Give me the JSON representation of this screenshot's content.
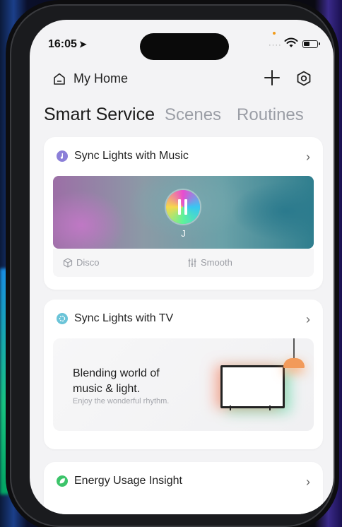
{
  "status": {
    "time": "16:05",
    "signal": "····"
  },
  "header": {
    "home_label": "My Home"
  },
  "tabs": [
    {
      "label": "Smart Service",
      "active": true
    },
    {
      "label": "Scenes",
      "active": false
    },
    {
      "label": "Routines",
      "active": false
    }
  ],
  "cards": {
    "music": {
      "title": "Sync Lights with Music",
      "player_name": "J",
      "mode_left": "Disco",
      "mode_right": "Smooth",
      "icon_color": "#8b7fd8"
    },
    "tv": {
      "title": "Sync Lights with TV",
      "headline": "Blending world of music & light.",
      "subtitle": "Enjoy the wonderful rhythm.",
      "icon_color": "#6bc4d8"
    },
    "energy": {
      "title": "Energy Usage Insight",
      "icon_color": "#3cc46a"
    }
  },
  "icons": [
    "location-arrow-icon",
    "wifi-icon",
    "battery-icon",
    "home-icon",
    "plus-icon",
    "settings-hex-icon",
    "music-note-icon",
    "chevron-right-icon",
    "cube-icon",
    "equalizer-icon",
    "pause-icon",
    "tv-icon",
    "leaf-icon"
  ]
}
